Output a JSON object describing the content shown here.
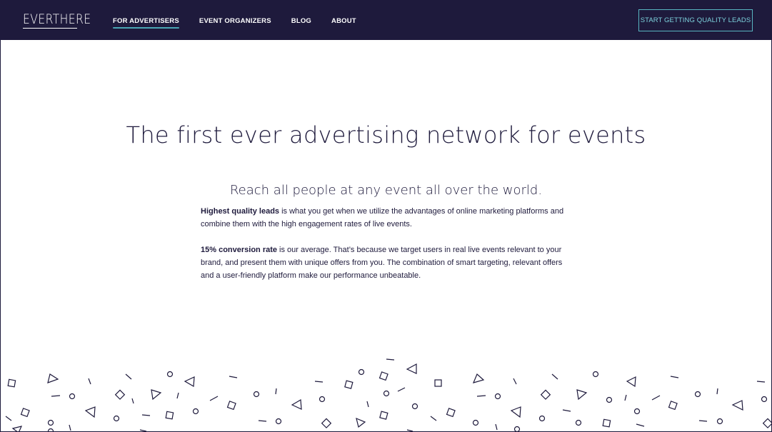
{
  "header": {
    "logo_text": "EVERTHERE",
    "nav": [
      {
        "label": "FOR ADVERTISERS",
        "active": true
      },
      {
        "label": "EVENT ORGANIZERS",
        "active": false
      },
      {
        "label": "BLOG",
        "active": false
      },
      {
        "label": "ABOUT",
        "active": false
      }
    ],
    "cta_label": "START GETTING QUALITY LEADS"
  },
  "hero": {
    "title": "The first ever advertising network for events",
    "subtitle": "Reach all people at any event all over the world.",
    "paragraphs": [
      {
        "bold": "Highest quality leads",
        "rest": " is what you get when we utilize the advantages of online marketing platforms and combine them with the high engagement rates of live events."
      },
      {
        "bold": "15% conversion rate",
        "rest": " is our average. That’s because we target users in real live events relevant to your brand, and present them with unique offers from you. The combination of smart targeting, relevant offers and a user-friendly platform make our performance unbeatable."
      }
    ]
  },
  "colors": {
    "navy": "#1e1a3c",
    "accent_teal": "#4aa6b4",
    "cta_text": "#7dd1dc",
    "background": "#ffffff"
  }
}
